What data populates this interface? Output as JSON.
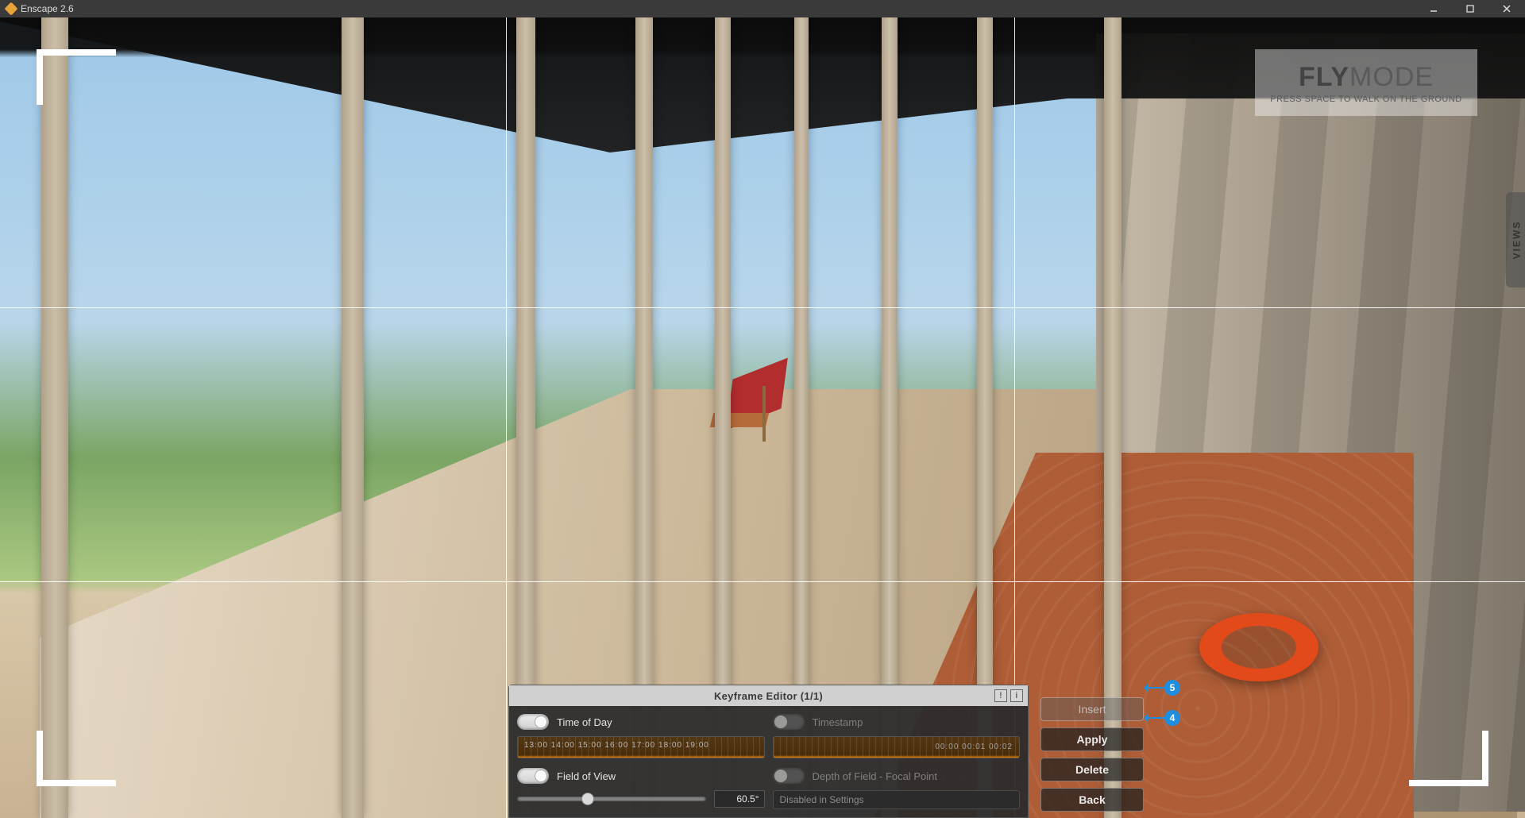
{
  "window": {
    "title": "Enscape 2.6"
  },
  "overlay": {
    "flymode_big_bold": "FLY",
    "flymode_big_light": "MODE",
    "flymode_sub": "PRESS SPACE TO WALK ON THE GROUND",
    "views_tab": "VIEWS"
  },
  "keyframe_editor": {
    "title": "Keyframe Editor  (1/1)",
    "left": {
      "time_of_day_label": "Time of Day",
      "time_ruler_labels": "13:00  14:00  15:00  16:00  17:00  18:00  19:00",
      "fov_label": "Field of View",
      "fov_value": "60.5°"
    },
    "right": {
      "timestamp_label": "Timestamp",
      "timestamp_ruler_labels": "00:00  00:01  00:02",
      "dof_label": "Depth of Field - Focal Point",
      "dof_info": "Disabled in Settings"
    }
  },
  "side_buttons": {
    "insert": "Insert",
    "apply": "Apply",
    "delete": "Delete",
    "back": "Back"
  },
  "annotations": {
    "a4": "4",
    "a5": "5"
  }
}
